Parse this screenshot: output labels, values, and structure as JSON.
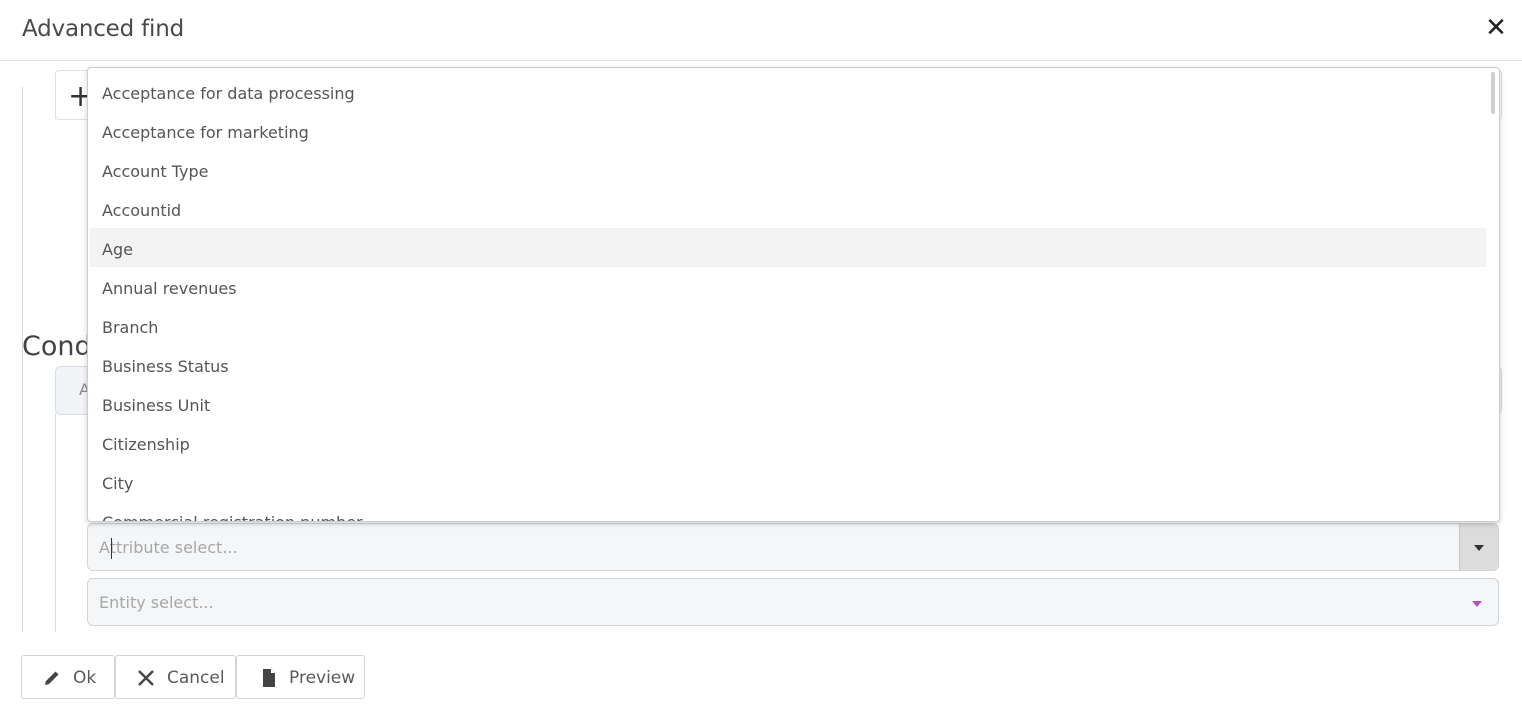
{
  "dialog": {
    "title": "Advanced find",
    "close_icon": "close-icon"
  },
  "conditions": {
    "section_title_visible": "Condi",
    "pill_letter_visible": "A"
  },
  "attribute_field": {
    "placeholder": "Attribute select...",
    "value": ""
  },
  "entity_field": {
    "placeholder": "Entity select...",
    "value": ""
  },
  "dropdown": {
    "highlighted_option": "Age",
    "options": [
      "Acceptance for data processing",
      "Acceptance for marketing",
      "Account Type",
      "Accountid",
      "Age",
      "Annual revenues",
      "Branch",
      "Business Status",
      "Business Unit",
      "Citizenship",
      "City",
      "Commercial registration number"
    ]
  },
  "footer": {
    "ok_label": "Ok",
    "cancel_label": "Cancel",
    "preview_label": "Preview"
  },
  "colors": {
    "accent_caret": "#b84fc0",
    "highlight_row": "#f3f3f3",
    "field_bg": "#f4f6f8"
  }
}
